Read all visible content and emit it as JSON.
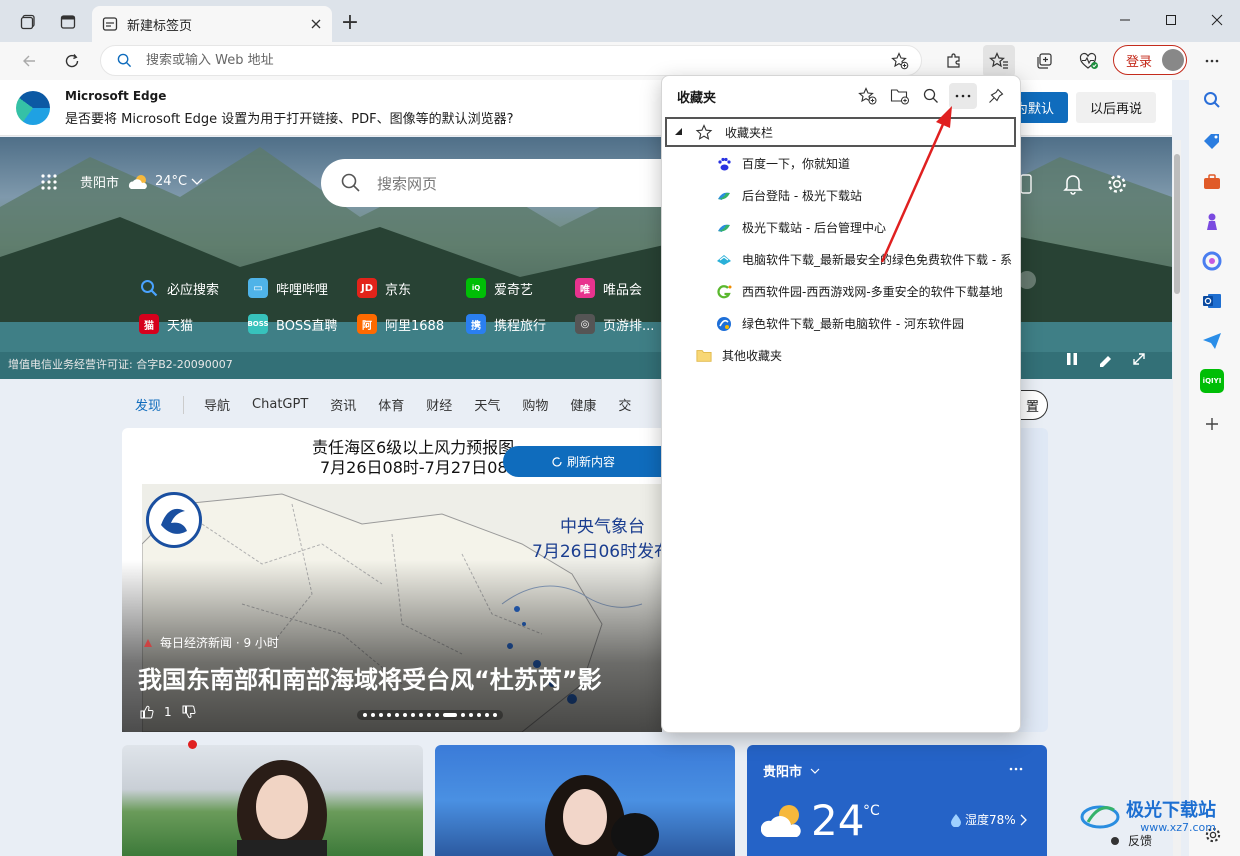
{
  "tab": {
    "title": "新建标签页",
    "close_icon": "close-icon"
  },
  "address_bar": {
    "placeholder": "搜索或输入 Web 地址"
  },
  "login": {
    "label": "登录"
  },
  "infobar": {
    "title": "Microsoft Edge",
    "text": "是否要将 Microsoft Edge 设置为用于打开链接、PDF、图像等的默认浏览器?",
    "primary_button": "为默认",
    "secondary_button": "以后再说"
  },
  "hero": {
    "city": "贵阳市",
    "temperature": "24°C",
    "search_placeholder": "搜索网页",
    "license": "增值电信业务经营许可证: 合字B2-20090007",
    "quick_links": [
      {
        "label": "必应搜索",
        "color": "#1e73d8"
      },
      {
        "label": "哔哩哔哩",
        "color": "#4fb3e8"
      },
      {
        "label": "京东",
        "color": "#e2231a"
      },
      {
        "label": "爱奇艺",
        "color": "#00be06"
      },
      {
        "label": "唯品会",
        "color": "#e8338e"
      },
      {
        "label": "天猫",
        "color": "#d6001c"
      },
      {
        "label": "BOSS直聘",
        "color": "#37c2bc"
      },
      {
        "label": "阿里1688",
        "color": "#ff6a00"
      },
      {
        "label": "携程旅行",
        "color": "#2a7ff0"
      },
      {
        "label": "页游排...",
        "color": "#555555"
      }
    ]
  },
  "category_nav": [
    "发现",
    "导航",
    "ChatGPT",
    "资讯",
    "体育",
    "财经",
    "天气",
    "购物",
    "健康",
    "交"
  ],
  "settings_button": "置",
  "news": {
    "headline1": "责任海区6级以上风力预报图",
    "headline2": "7月26日08时-7月27日08",
    "map_title1": "中央气象台",
    "map_title2": "7月26日06时发布",
    "refresh": "刷新内容",
    "source": "每日经济新闻 · 9 小时",
    "title": "我国东南部和南部海域将受台风“杜苏芮”影",
    "likes": "1"
  },
  "weather_card": {
    "city": "贵阳市",
    "temp": "24",
    "unit": "°C",
    "humidity": "湿度78%"
  },
  "favorites": {
    "title": "收藏夹",
    "bar_label": "收藏夹栏",
    "items": [
      {
        "label": "百度一下，你就知道",
        "icon": "baidu-icon"
      },
      {
        "label": "后台登陆 - 极光下载站",
        "icon": "jiguang-icon"
      },
      {
        "label": "极光下载站 - 后台管理中心",
        "icon": "jiguang-icon"
      },
      {
        "label": "电脑软件下载_最新最安全的绿色免费软件下载 - 系",
        "icon": "pc-soft-icon"
      },
      {
        "label": "西西软件园-西西游戏网-多重安全的软件下载基地",
        "icon": "xixi-icon"
      },
      {
        "label": "绿色软件下载_最新电脑软件 - 河东软件园",
        "icon": "hedong-icon"
      }
    ],
    "other": "其他收藏夹"
  },
  "feedback": "反馈",
  "watermark": {
    "text": "极光下载站",
    "url": "www.xz7.com"
  },
  "colors": {
    "accent": "#0f6cbd",
    "login": "#c42b1c",
    "arrow": "#e02020"
  }
}
